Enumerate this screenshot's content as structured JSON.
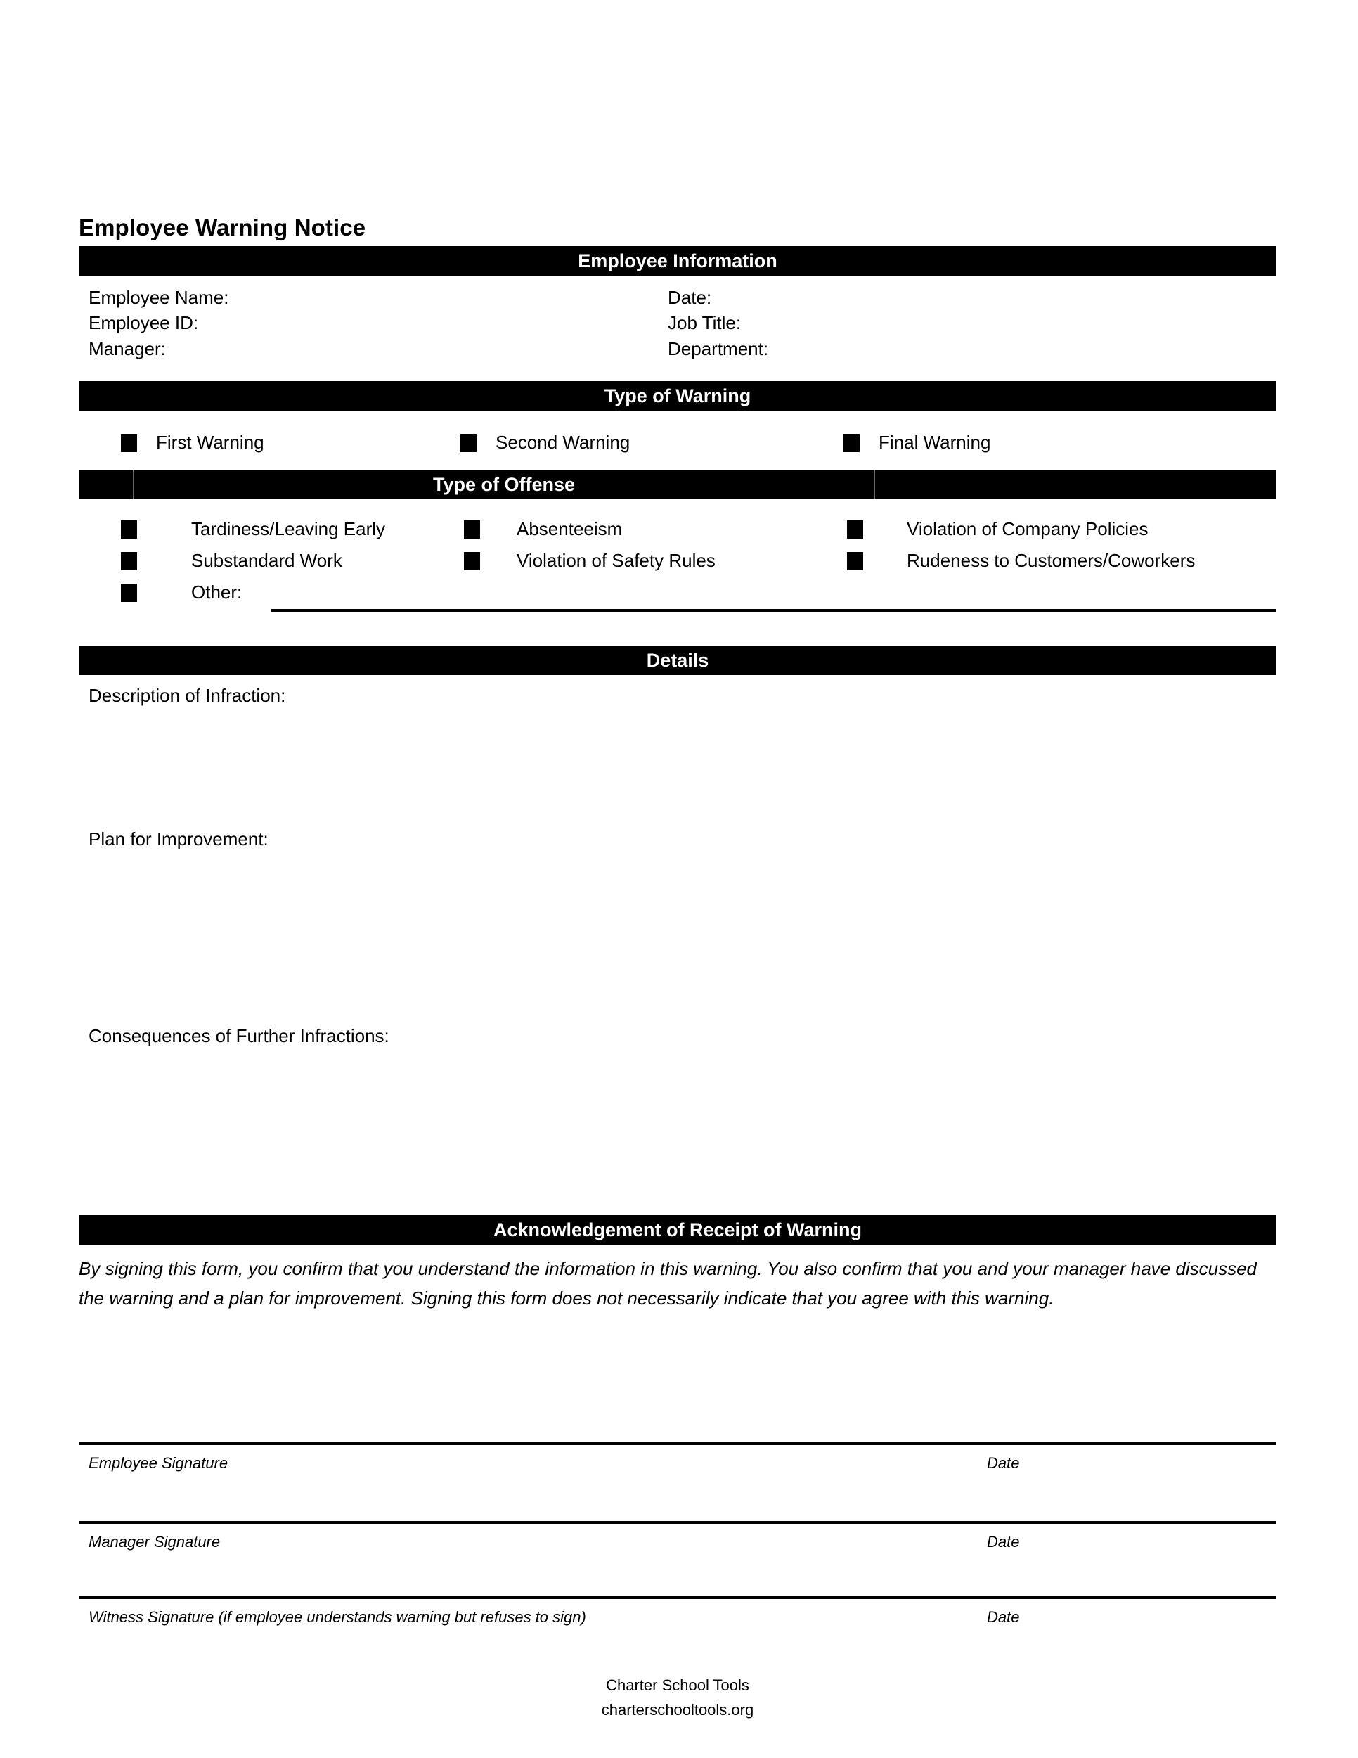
{
  "document": {
    "title": "Employee Warning Notice"
  },
  "sections": {
    "employee_information": {
      "heading": "Employee Information",
      "fields_left": [
        {
          "label": "Employee Name:",
          "value": ""
        },
        {
          "label": "Employee ID:",
          "value": ""
        },
        {
          "label": "Manager:",
          "value": ""
        }
      ],
      "fields_right": [
        {
          "label": "Date:",
          "value": ""
        },
        {
          "label": "Job Title:",
          "value": ""
        },
        {
          "label": "Department:",
          "value": ""
        }
      ]
    },
    "type_of_warning": {
      "heading": "Type of Warning",
      "options": [
        {
          "label": "First Warning",
          "checked": false
        },
        {
          "label": "Second Warning",
          "checked": false
        },
        {
          "label": "Final Warning",
          "checked": false
        }
      ]
    },
    "type_of_offense": {
      "heading": "Type of Offense",
      "options": [
        {
          "label": "Tardiness/Leaving Early",
          "checked": false
        },
        {
          "label": "Absenteeism",
          "checked": false
        },
        {
          "label": "Violation of Company Policies",
          "checked": false
        },
        {
          "label": "Substandard Work",
          "checked": false
        },
        {
          "label": "Violation of Safety Rules",
          "checked": false
        },
        {
          "label": "Rudeness to Customers/Coworkers",
          "checked": false
        }
      ],
      "other": {
        "label": "Other:",
        "checked": false,
        "value": ""
      }
    },
    "details": {
      "heading": "Details",
      "prompts": [
        {
          "label": "Description of Infraction:",
          "value": ""
        },
        {
          "label": "Plan for Improvement:",
          "value": ""
        },
        {
          "label": "Consequences of Further Infractions:",
          "value": ""
        }
      ]
    },
    "acknowledgement": {
      "heading": "Acknowledgement of Receipt of Warning",
      "body": "By signing this form, you confirm that you understand the information in this warning. You also confirm that you and your manager have discussed the warning and a plan for improvement. Signing this form does not necessarily indicate that you agree with this warning.",
      "signatures": [
        {
          "name_label": "Employee Signature",
          "date_label": "Date"
        },
        {
          "name_label": "Manager Signature",
          "date_label": "Date"
        },
        {
          "name_label": "Witness Signature (if employee understands warning but refuses to sign)",
          "date_label": "Date"
        }
      ]
    }
  },
  "footer": {
    "organization": "Charter School Tools",
    "website": "charterschooltools.org"
  }
}
